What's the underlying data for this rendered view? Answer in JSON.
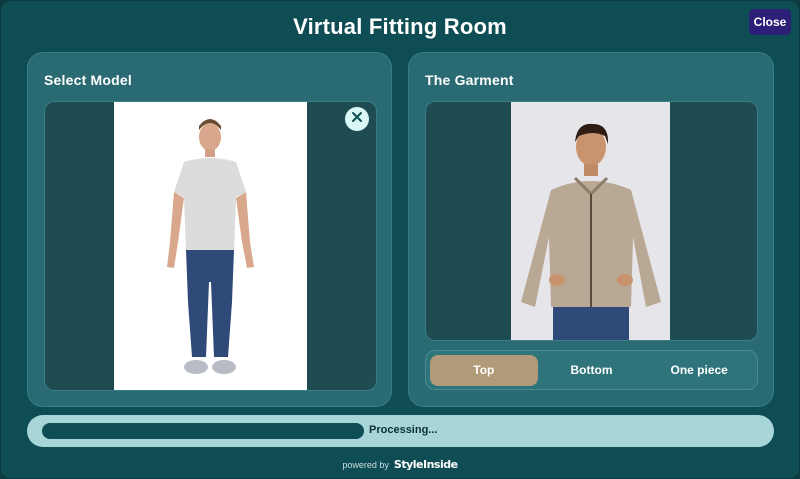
{
  "header": {
    "title": "Virtual Fitting Room",
    "close_label": "Close"
  },
  "model_panel": {
    "title": "Select Model"
  },
  "garment_panel": {
    "title": "The Garment",
    "options": [
      {
        "label": "Top",
        "selected": true
      },
      {
        "label": "Bottom",
        "selected": false
      },
      {
        "label": "One piece",
        "selected": false
      }
    ]
  },
  "progress": {
    "label": "Processing...",
    "fraction": 0.45
  },
  "footer": {
    "powered_by": "powered by",
    "brand": "StyleInside"
  },
  "colors": {
    "background": "#0f4d54",
    "panel": "#2a6a72",
    "accent_selected": "#b09a78",
    "close_button": "#2c1f78",
    "progress_bg": "#a8d6d8"
  },
  "icons": {
    "remove": "close-icon"
  }
}
